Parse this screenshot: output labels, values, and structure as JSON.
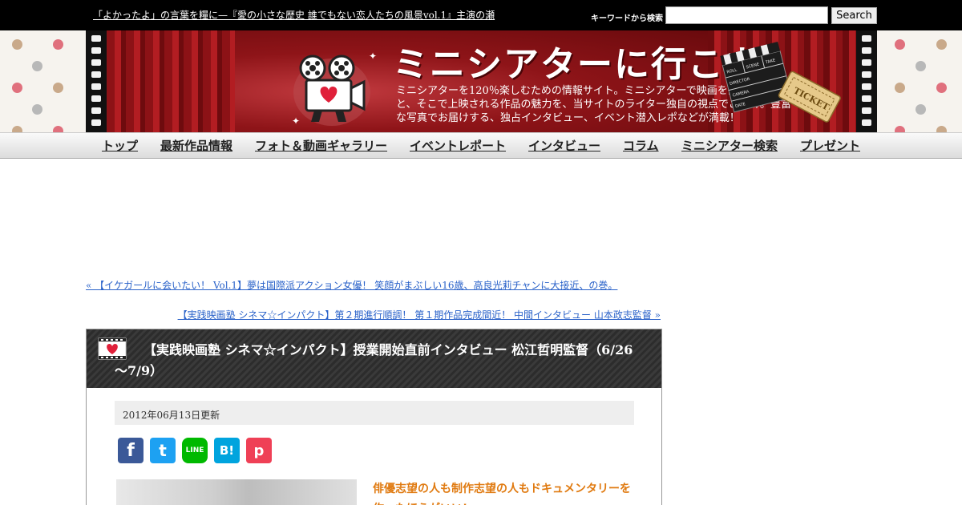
{
  "topbar": {
    "ticker_text": "「よかったよ」の言葉を糧に—『愛の小さな歴史 誰でもない恋人たちの風景vol.1』主演の瀬",
    "search_label": "キーワードから検索",
    "search_value": "",
    "search_button": "Search"
  },
  "banner": {
    "title": "ミニシアターに行こウ。",
    "description": "ミニシアターを120％楽しむための情報サイト。ミニシアターで映画を観る楽しみと、そこで上映される作品の魅力を、当サイトのライター独自の視点でご紹介。豊富な写真でお届けする、独占インタビュー、イベント潜入レポなどが満載！",
    "ticket_text": "TICKET",
    "clapper_labels": [
      "ROLL",
      "SCENE",
      "TAKE",
      "DIRECTOR",
      "CAMERA",
      "DATE"
    ]
  },
  "nav": {
    "items": [
      {
        "label": "トップ"
      },
      {
        "label": "最新作品情報"
      },
      {
        "label": "フォト＆動画ギャラリー"
      },
      {
        "label": "イベントレポート"
      },
      {
        "label": "インタビュー"
      },
      {
        "label": "コラム"
      },
      {
        "label": "ミニシアター検索"
      },
      {
        "label": "プレゼント"
      }
    ]
  },
  "pager": {
    "prev": "« 【イケガールに会いたい！ Vol.1】夢は国際派アクション女優！ 笑顔がまぶしい16歳、高良光莉チャンに大接近、の巻。",
    "next": "【実践映画塾 シネマ☆インパクト】第２期進行順調！ 第１期作品完成間近！ 中間インタビュー 山本政志監督 »"
  },
  "article": {
    "title": "【実践映画塾 シネマ☆インパクト】授業開始直前インタビュー 松江哲明監督（6/26～7/9）",
    "date": "2012年06月13日更新",
    "lead": "俳優志望の人も制作志望の人もドキュメンタリーを作ったほうがいい!",
    "share": [
      {
        "name": "facebook",
        "glyph": "f",
        "color": "#3b5998"
      },
      {
        "name": "twitter",
        "glyph": "t",
        "color": "#1da1f2"
      },
      {
        "name": "line",
        "glyph": "LINE",
        "color": "#00b900"
      },
      {
        "name": "hatena",
        "glyph": "B!",
        "color": "#00a4de"
      },
      {
        "name": "pocket",
        "glyph": "p",
        "color": "#ef4056"
      }
    ]
  },
  "colors": {
    "link": "#2a62c9",
    "accent_orange": "#e07a10",
    "banner_red": "#7a0f12"
  }
}
